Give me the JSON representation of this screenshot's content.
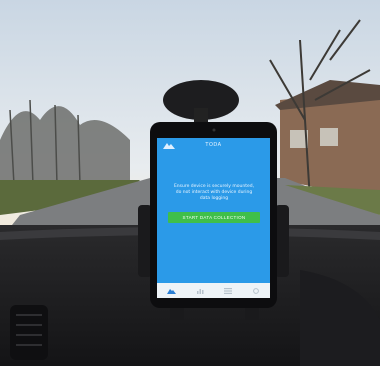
{
  "scene": {
    "description_free": true
  },
  "phone_screen": {
    "app_title": "TODA",
    "status_bar": "",
    "instruction_text": "Ensure device is securely mounted, do not interact with device during data logging",
    "start_button_label": "START DATA COLLECTION",
    "background_color": "#2b9ae8",
    "button_color": "#3fbf4a",
    "nav_icons": [
      "home-icon",
      "chart-icon",
      "list-icon",
      "settings-icon"
    ]
  }
}
